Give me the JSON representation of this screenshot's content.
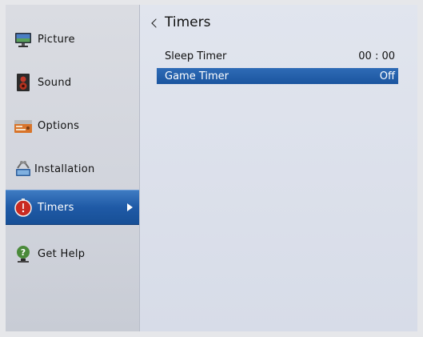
{
  "sidebar": {
    "items": [
      {
        "label": "Picture",
        "icon": "picture-icon"
      },
      {
        "label": "Sound",
        "icon": "sound-icon"
      },
      {
        "label": "Options",
        "icon": "options-icon"
      },
      {
        "label": "Installation",
        "icon": "installation-icon"
      },
      {
        "label": "Timers",
        "icon": "timers-icon",
        "selected": true
      },
      {
        "label": "Get Help",
        "icon": "get-help-icon"
      }
    ]
  },
  "main": {
    "title": "Timers",
    "settings": [
      {
        "label": "Sleep Timer",
        "value": "00 : 00"
      },
      {
        "label": "Game Timer",
        "value": "Off",
        "selected": true
      }
    ]
  },
  "colors": {
    "selection": "#1f5aa6",
    "background": "#d6dbe6"
  }
}
